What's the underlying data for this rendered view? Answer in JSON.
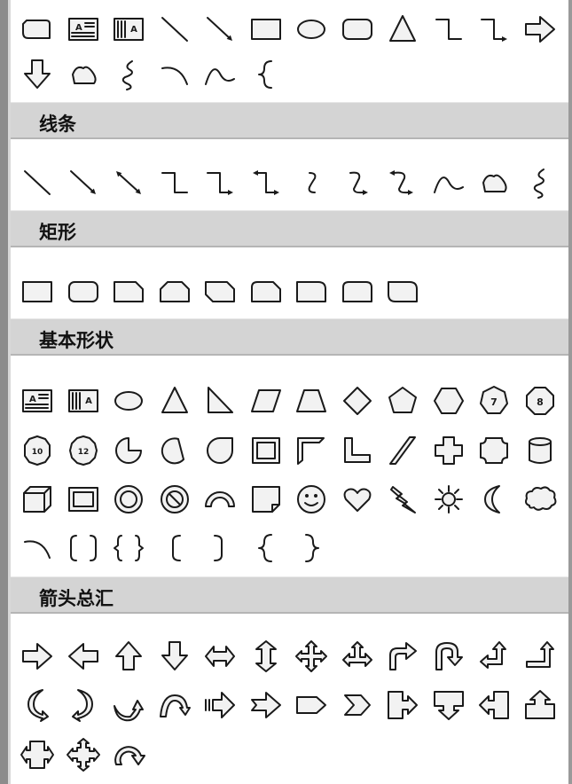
{
  "sections": [
    {
      "id": "recent",
      "title": "",
      "rows": [
        [
          "snip-corner-rect-icon",
          "text-box-icon",
          "vertical-text-box-icon",
          "line-icon",
          "arrow-line-icon",
          "rectangle-icon",
          "oval-icon",
          "rounded-rectangle-icon",
          "triangle-icon",
          "elbow-connector-icon",
          "elbow-arrow-connector-icon",
          "right-arrow-icon"
        ],
        [
          "down-arrow-icon",
          "freeform-icon",
          "scribble-icon",
          "arc-icon",
          "curve-icon",
          "left-brace-icon"
        ]
      ]
    },
    {
      "id": "lines",
      "title": "线条",
      "rows": [
        [
          "line-icon",
          "arrow-line-icon",
          "double-arrow-line-icon",
          "elbow-connector-icon",
          "elbow-arrow-connector-icon",
          "elbow-double-arrow-connector-icon",
          "curved-connector-icon",
          "curved-arrow-connector-icon",
          "curved-double-arrow-connector-icon",
          "curve-icon",
          "freeform-icon",
          "scribble-icon"
        ]
      ]
    },
    {
      "id": "rectangles",
      "title": "矩形",
      "rows": [
        [
          "rectangle-icon",
          "rounded-rectangle-icon",
          "snip-single-corner-rect-icon",
          "snip-same-side-corner-rect-icon",
          "snip-diagonal-corner-rect-icon",
          "snip-round-single-corner-rect-icon",
          "round-single-corner-rect-icon",
          "round-same-side-corner-rect-icon",
          "round-diagonal-corner-rect-icon"
        ]
      ]
    },
    {
      "id": "basic",
      "title": "基本形状",
      "rows": [
        [
          "text-box-icon",
          "vertical-text-box-icon",
          "oval-icon",
          "triangle-icon",
          "right-triangle-icon",
          "parallelogram-icon",
          "trapezoid-icon",
          "diamond-icon",
          "pentagon-icon",
          "hexagon-icon",
          "heptagon-icon",
          "octagon-icon"
        ],
        [
          "decagon-icon",
          "dodecagon-icon",
          "pie-icon",
          "chord-icon",
          "teardrop-icon",
          "frame-icon",
          "half-frame-icon",
          "l-shape-icon",
          "diagonal-stripe-icon",
          "cross-icon",
          "plaque-icon",
          "can-icon"
        ],
        [
          "cube-icon",
          "bevel-icon",
          "donut-icon",
          "no-symbol-icon",
          "block-arc-icon",
          "folded-corner-icon",
          "smiley-face-icon",
          "heart-icon",
          "lightning-bolt-icon",
          "sun-icon",
          "moon-icon",
          "cloud-icon"
        ],
        [
          "arc-icon",
          "double-bracket-icon",
          "double-brace-icon",
          "left-bracket-icon",
          "right-bracket-icon",
          "left-brace-icon",
          "right-brace-icon"
        ]
      ]
    },
    {
      "id": "arrows",
      "title": "箭头总汇",
      "rows": [
        [
          "right-arrow-icon",
          "left-arrow-icon",
          "up-arrow-icon",
          "down-arrow-icon",
          "left-right-arrow-icon",
          "up-down-arrow-icon",
          "quad-arrow-icon",
          "left-right-up-arrow-icon",
          "bent-arrow-icon",
          "u-turn-arrow-icon",
          "left-up-arrow-icon",
          "bent-up-arrow-icon"
        ],
        [
          "curved-right-arrow-icon",
          "curved-left-arrow-icon",
          "curved-up-arrow-icon",
          "curved-down-arrow-icon",
          "striped-right-arrow-icon",
          "notched-right-arrow-icon",
          "pentagon-arrow-icon",
          "chevron-icon",
          "right-arrow-callout-icon",
          "down-arrow-callout-icon",
          "left-arrow-callout-icon",
          "up-arrow-callout-icon"
        ],
        [
          "left-right-arrow-callout-icon",
          "quad-arrow-callout-icon",
          "circular-arrow-icon"
        ]
      ]
    }
  ],
  "numbers": {
    "heptagon": "7",
    "octagon": "8",
    "decagon": "10",
    "dodecagon": "12"
  },
  "text_box_glyph": "A",
  "colors": {
    "header_bg": "#d4d4d4",
    "shape_stroke": "#1a1a1a",
    "shape_fill": "#f2f2f2"
  }
}
